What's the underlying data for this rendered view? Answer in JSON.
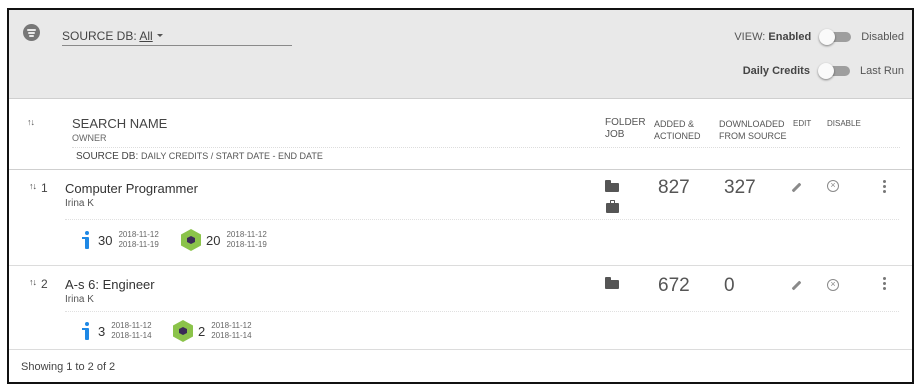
{
  "header": {
    "source_db_label": "SOURCE DB:",
    "source_db_value": "All",
    "view_label": "VIEW:",
    "view_enabled": "Enabled",
    "view_disabled": "Disabled",
    "credits_label": "Daily Credits",
    "credits_alt": "Last Run"
  },
  "columns": {
    "search_name": "SEARCH NAME",
    "owner": "OWNER",
    "source_db": "SOURCE DB:",
    "source_db_detail": "DAILY CREDITS / START DATE - END DATE",
    "folder": "FOLDER",
    "job": "JOB",
    "added_1": "ADDED &",
    "added_2": "ACTIONED",
    "downloaded_1": "DOWNLOADED",
    "downloaded_2": "FROM SOURCE",
    "edit": "EDIT",
    "disable": "DISABLE"
  },
  "rows": [
    {
      "index": "1",
      "title": "Computer Programmer",
      "owner": "Irina K",
      "added": "827",
      "downloaded": "327",
      "stats": [
        {
          "icon": "info-icon",
          "value": "30",
          "start": "2018-11-12",
          "end": "2018-11-19"
        },
        {
          "icon": "hexagon-source-icon",
          "value": "20",
          "start": "2018-11-12",
          "end": "2018-11-19"
        }
      ]
    },
    {
      "index": "2",
      "title": "A-s 6: Engineer",
      "owner": "Irina K",
      "added": "672",
      "downloaded": "0",
      "stats": [
        {
          "icon": "info-icon",
          "value": "3",
          "start": "2018-11-12",
          "end": "2018-11-14"
        },
        {
          "icon": "hexagon-source-icon",
          "value": "2",
          "start": "2018-11-12",
          "end": "2018-11-14"
        }
      ]
    }
  ],
  "footer": {
    "showing": "Showing 1 to 2 of 2"
  },
  "colors": {
    "header_bg": "#e9e9e9",
    "info_blue": "#1e88e5",
    "hex_green": "#8bc34a",
    "toggle_track": "#9e9e9e"
  }
}
